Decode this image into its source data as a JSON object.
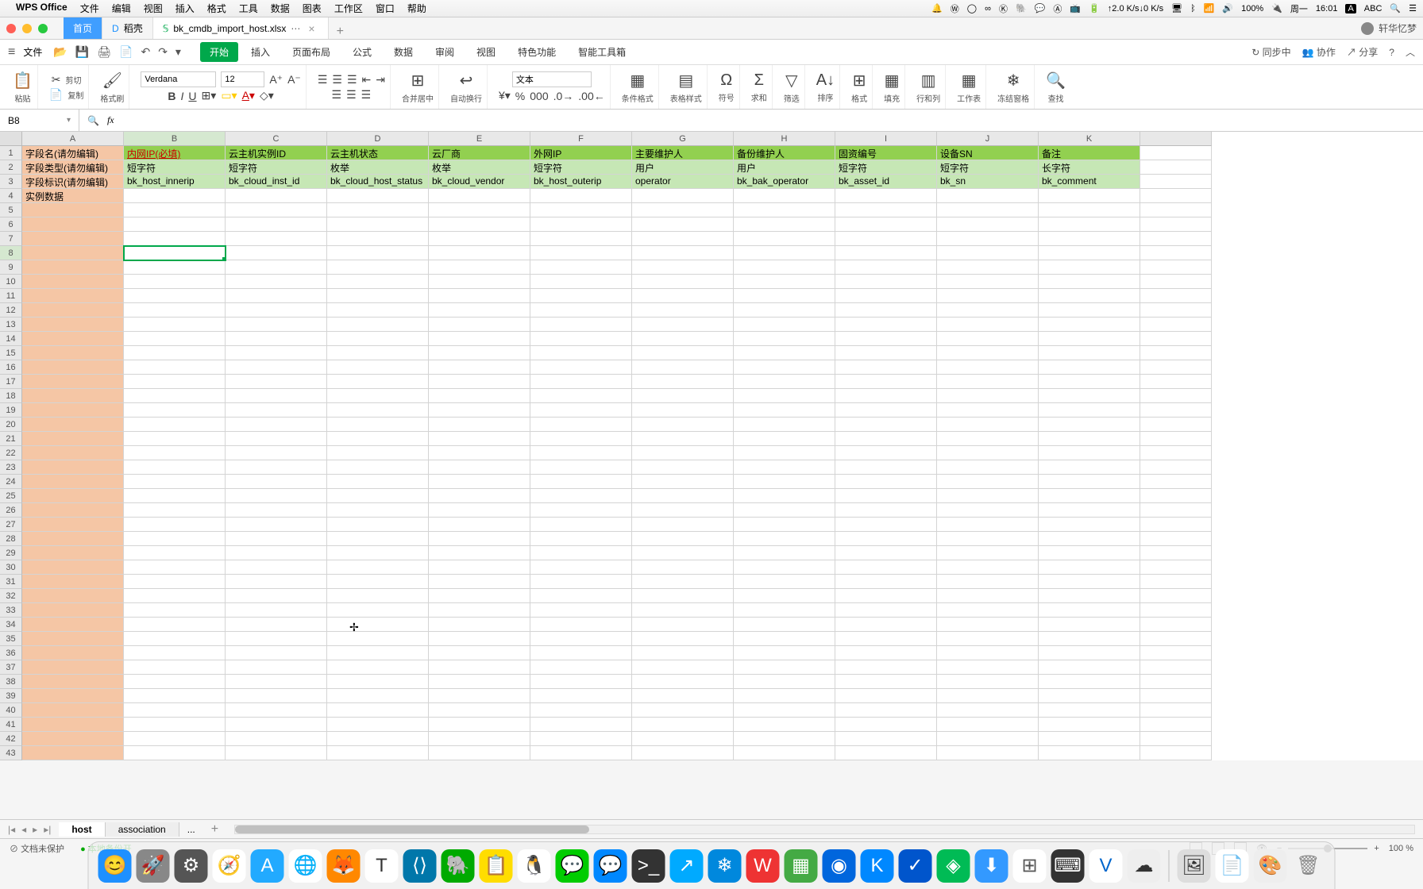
{
  "menubar": {
    "app": "WPS Office",
    "items": [
      "文件",
      "编辑",
      "视图",
      "插入",
      "格式",
      "工具",
      "数据",
      "图表",
      "工作区",
      "窗口",
      "帮助"
    ],
    "right": {
      "net_up": "2.0 K/s",
      "net_down": "0 K/s",
      "battery": "100%",
      "day": "周一",
      "time": "16:01",
      "ime": "ABC"
    }
  },
  "tabs": {
    "home": "首页",
    "docer": "稻壳",
    "file": "bk_cmdb_import_host.xlsx",
    "user": "轩华忆梦"
  },
  "toolbar": {
    "file_label": "文件",
    "ribbon": [
      "开始",
      "插入",
      "页面布局",
      "公式",
      "数据",
      "审阅",
      "视图",
      "特色功能",
      "智能工具箱"
    ],
    "right": {
      "sync": "同步中",
      "collab": "协作",
      "share": "分享"
    },
    "paste": "粘贴",
    "cut": "剪切",
    "copy": "复制",
    "format_painter": "格式刷",
    "font": "Verdana",
    "size": "12",
    "merge": "合并居中",
    "wrap": "自动换行",
    "number_format": "文本",
    "cond_format": "条件格式",
    "table_style": "表格样式",
    "symbol": "符号",
    "sum": "求和",
    "filter": "筛选",
    "sort": "排序",
    "format": "格式",
    "fill": "填充",
    "row_col": "行和列",
    "worksheet": "工作表",
    "freeze": "冻结窗格",
    "find": "查找"
  },
  "formula": {
    "cell_ref": "B8",
    "fx": "fx"
  },
  "columns": [
    "A",
    "B",
    "C",
    "D",
    "E",
    "F",
    "G",
    "H",
    "I",
    "J",
    "K"
  ],
  "data": {
    "A1": "字段名(请勿编辑)",
    "B1": "内网IP(必填)",
    "C1": "云主机实例ID",
    "D1": "云主机状态",
    "E1": "云厂商",
    "F1": "外网IP",
    "G1": "主要维护人",
    "H1": "备份维护人",
    "I1": "固资编号",
    "J1": "设备SN",
    "K1": "备注",
    "A2": "字段类型(请勿编辑)",
    "B2": "短字符",
    "C2": "短字符",
    "D2": "枚举",
    "E2": "枚举",
    "F2": "短字符",
    "G2": "用户",
    "H2": "用户",
    "I2": "短字符",
    "J2": "短字符",
    "K2": "长字符",
    "A3": "字段标识(请勿编辑)",
    "B3": "bk_host_innerip",
    "C3": "bk_cloud_inst_id",
    "D3": "bk_cloud_host_status",
    "E3": "bk_cloud_vendor",
    "F3": "bk_host_outerip",
    "G3": "operator",
    "H3": "bk_bak_operator",
    "I3": "bk_asset_id",
    "J3": "bk_sn",
    "K3": "bk_comment",
    "A4": "实例数据"
  },
  "sheets": {
    "active": "host",
    "other": "association",
    "more": "..."
  },
  "statusbar": {
    "protected": "文档未保护",
    "backup": "本地备份开",
    "zoom": "100 %"
  }
}
